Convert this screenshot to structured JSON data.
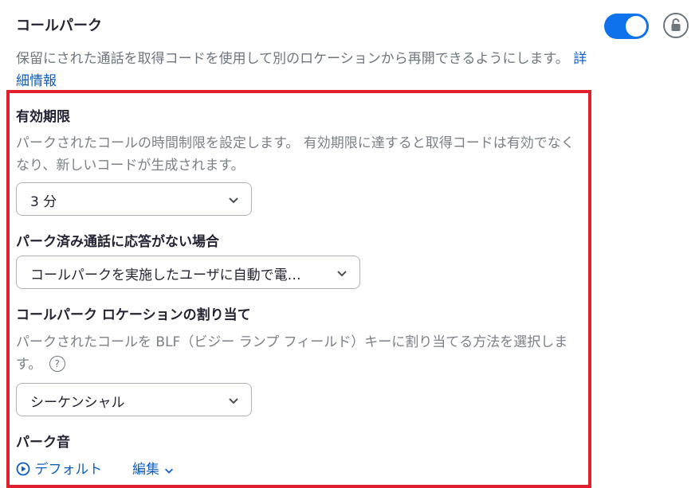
{
  "header": {
    "title": "コールパーク",
    "description": "保留にされた通話を取得コードを使用して別のロケーションから再開できるようにします。",
    "link": "詳細情報"
  },
  "toggle": {
    "state": "on",
    "color": "#0e72ed"
  },
  "expiry": {
    "label": "有効期限",
    "description": "パークされたコールの時間制限を設定します。 有効期限に達すると取得コードは有効でなくなり、新しいコードが生成されます。",
    "value": "3 分"
  },
  "unanswered": {
    "label": "パーク済み通話に応答がない場合",
    "value": "コールパークを実施したユーザに自動で電…"
  },
  "location": {
    "label": "コールパーク ロケーションの割り当て",
    "description": "パークされたコールを BLF（ビジー ランプ フィールド）キーに割り当てる方法を選択します。",
    "help": "?",
    "value": "シーケンシャル"
  },
  "sound": {
    "label": "パーク音",
    "default_link": "デフォルト",
    "edit_link": "編集"
  },
  "highlight_color": "#e0202a"
}
